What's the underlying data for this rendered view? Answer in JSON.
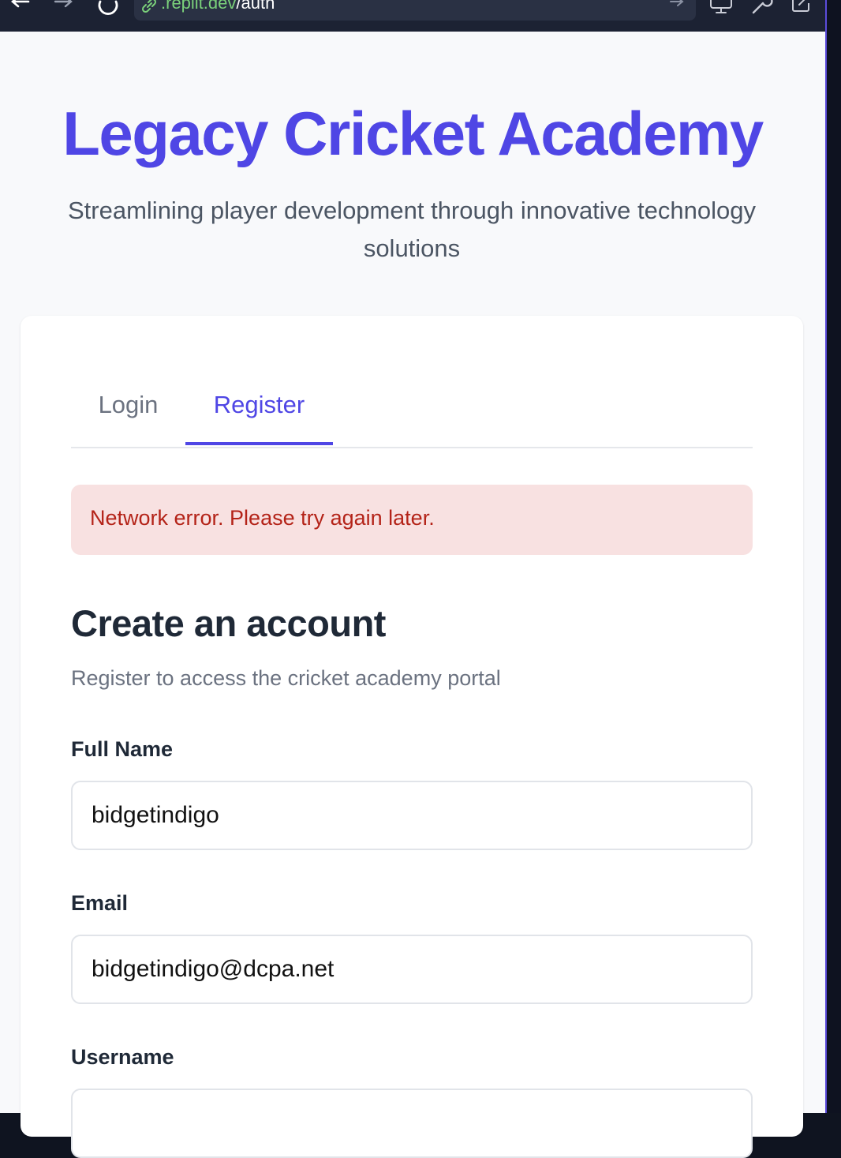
{
  "browser": {
    "url_host": ".replit.dev",
    "url_path": "/auth"
  },
  "hero": {
    "title": "Legacy Cricket Academy",
    "subtitle": "Streamlining player development through innovative technology solutions"
  },
  "tabs": [
    {
      "label": "Login",
      "active": false
    },
    {
      "label": "Register",
      "active": true
    }
  ],
  "alert": {
    "message": "Network error. Please try again later."
  },
  "form": {
    "title": "Create an account",
    "description": "Register to access the cricket academy portal",
    "fields": [
      {
        "label": "Full Name",
        "value": "bidgetindigo"
      },
      {
        "label": "Email",
        "value": "bidgetindigo@dcpa.net"
      },
      {
        "label": "Username",
        "value": ""
      }
    ]
  },
  "colors": {
    "brand": "#4f46e5",
    "error_bg": "#f8e1e1",
    "error_text": "#b42318"
  }
}
